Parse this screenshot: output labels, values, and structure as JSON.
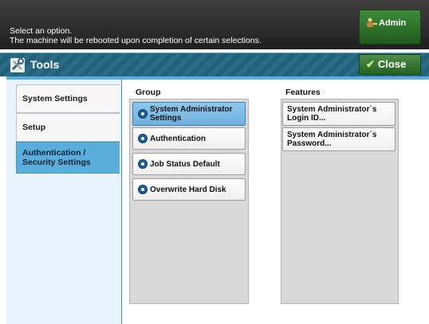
{
  "status": {
    "line1": "Select an option.",
    "line2": "The machine will be rebooted upon completion of certain selections."
  },
  "admin": {
    "label": "Admin",
    "icon": "user-key-icon"
  },
  "window": {
    "title": "Tools",
    "icon": "tools-icon",
    "close_label": "Close"
  },
  "tabs": [
    {
      "label": "System Settings"
    },
    {
      "label": "Setup"
    },
    {
      "label_line1": "Authentication /",
      "label_line2": "Security Settings",
      "active": true
    }
  ],
  "group": {
    "heading": "Group",
    "items": [
      {
        "line1": "System Administrator",
        "line2": "Settings",
        "selected": true
      },
      {
        "label": "Authentication"
      },
      {
        "label": "Job Status Default"
      },
      {
        "label": "Overwrite Hard Disk"
      }
    ]
  },
  "features": {
    "heading": "Features",
    "items": [
      {
        "line1": "System Administrator`s",
        "line2": "Login ID..."
      },
      {
        "line1": "System Administrator`s",
        "line2": "Password..."
      }
    ]
  },
  "colors": {
    "accent": "#5aaedb",
    "selected": "#8ec8ec",
    "green": "#3d8c3a"
  }
}
